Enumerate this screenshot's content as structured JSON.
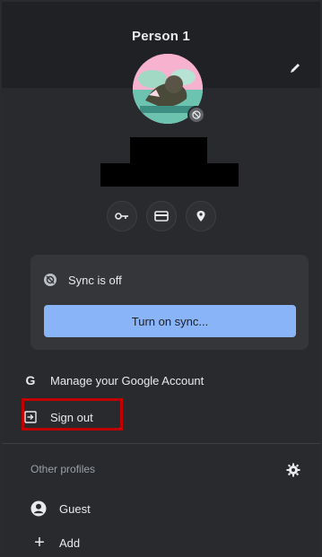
{
  "profile": {
    "name": "Person 1"
  },
  "icons": {
    "edit": "pencil-icon",
    "avatar_badge": "sync-paused-icon",
    "passwords": "key-icon",
    "payments": "credit-card-icon",
    "addresses": "location-pin-icon",
    "sync_status": "sync-off-icon",
    "google": "google-g-icon",
    "sign_out": "sign-out-icon",
    "settings": "gear-icon",
    "guest": "person-icon",
    "add": "plus-icon"
  },
  "sync": {
    "status_text": "Sync is off",
    "button_label": "Turn on sync..."
  },
  "menu": {
    "manage_account": "Manage your Google Account",
    "sign_out": "Sign out"
  },
  "other_profiles": {
    "heading": "Other profiles",
    "items": [
      {
        "label": "Guest"
      },
      {
        "label": "Add"
      }
    ]
  },
  "colors": {
    "accent": "#8ab4f8",
    "highlight": "#c00000",
    "background": "#292a2d",
    "header": "#202124"
  },
  "glyphs": {
    "google_letter": "G",
    "plus": "+"
  }
}
